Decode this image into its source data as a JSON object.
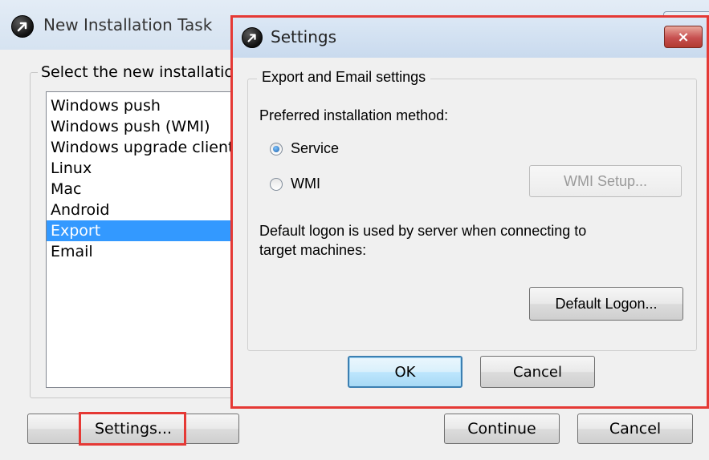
{
  "background_window": {
    "title": "New Installation Task",
    "group_label": "Select the new installation type:",
    "items": [
      {
        "label": "Windows push",
        "selected": false
      },
      {
        "label": "Windows push (WMI)",
        "selected": false
      },
      {
        "label": "Windows upgrade client",
        "selected": false
      },
      {
        "label": "Linux",
        "selected": false
      },
      {
        "label": "Mac",
        "selected": false
      },
      {
        "label": "Android",
        "selected": false
      },
      {
        "label": "Export",
        "selected": true
      },
      {
        "label": "Email",
        "selected": false
      }
    ],
    "buttons": {
      "settings": "Settings...",
      "continue": "Continue",
      "cancel": "Cancel"
    }
  },
  "settings_dialog": {
    "title": "Settings",
    "close_glyph": "×",
    "group_label": "Export and Email settings",
    "preferred_method_label": "Preferred installation method:",
    "methods": [
      {
        "label": "Service",
        "checked": true
      },
      {
        "label": "WMI",
        "checked": false
      }
    ],
    "wmi_setup_button": "WMI Setup...",
    "logon_text_line1": "Default logon is used by server when connecting to",
    "logon_text_line2": "target machines:",
    "default_logon_button": "Default Logon...",
    "ok_button": "OK",
    "cancel_button": "Cancel"
  },
  "colors": {
    "highlight": "#e53935",
    "selection": "#3399ff"
  },
  "icons": {
    "app_icon": "arrow-up-right-circle-icon",
    "close": "close-icon"
  }
}
